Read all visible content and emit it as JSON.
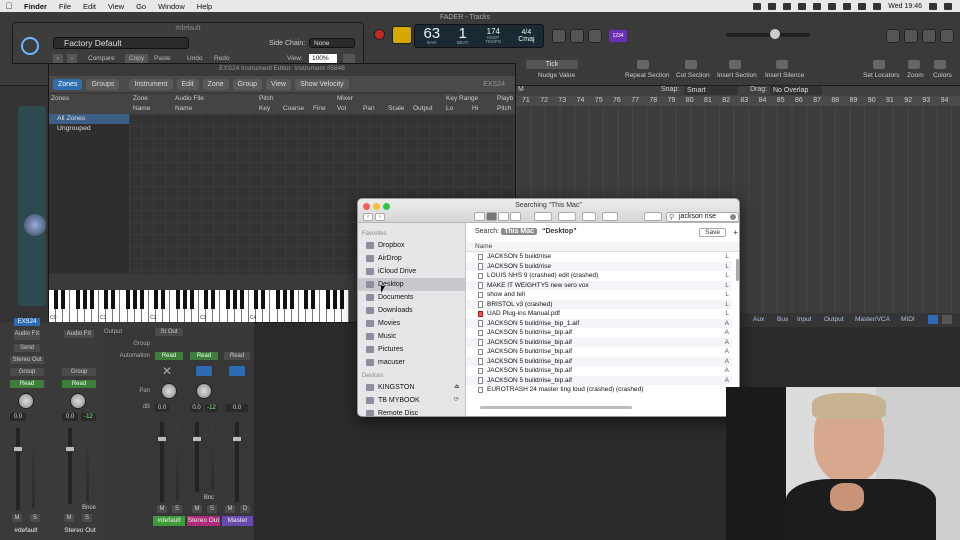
{
  "menubar": {
    "app": "Finder",
    "items": [
      "File",
      "Edit",
      "View",
      "Go",
      "Window",
      "Help"
    ],
    "clock": "Wed 19:46"
  },
  "logic": {
    "window_title": "FADER - Tracks",
    "lcd": {
      "bar": "63",
      "beat": "1",
      "bar_label": "BAR",
      "beat_label": "BEAT",
      "tempo": "174",
      "tempo_label": "TEMPO",
      "keep": "KEEP",
      "sig": "4/4",
      "key": "Cmaj"
    },
    "lcd_badge": "1234",
    "toolbar_labels": [
      "Repeat Section",
      "Cut Section",
      "Insert Section",
      "Insert Silence",
      "Set Locators",
      "Zoom",
      "Colors"
    ],
    "nudge": {
      "mode": "Tick",
      "label": "Nudge Value"
    },
    "snap": {
      "label": "Snap:",
      "value": "Smart"
    },
    "drag": {
      "label": "Drag:",
      "value": "No Overlap"
    },
    "marker_label": "M",
    "ruler": [
      "71",
      "72",
      "73",
      "74",
      "75",
      "76",
      "77",
      "78",
      "79",
      "80",
      "81",
      "82",
      "83",
      "84",
      "85",
      "86",
      "87",
      "88",
      "89",
      "90",
      "91",
      "92",
      "93",
      "94"
    ],
    "mixer_tabs": [
      "Aux",
      "Bus",
      "Input",
      "Output",
      "Master/VCA",
      "MIDI"
    ]
  },
  "plugin": {
    "title": "#default",
    "preset": "Factory Default",
    "sidechain_label": "Side Chain:",
    "sidechain_value": "None",
    "view_label": "View:",
    "view_value": "100%",
    "buttons": [
      "Compare",
      "Copy",
      "Paste",
      "Undo",
      "Redo"
    ]
  },
  "exs": {
    "title": "EXS24 Instrument Editor: Instrument #5846",
    "tabs": [
      "Zones",
      "Groups",
      "Instrument",
      "Edit",
      "Zone",
      "Group",
      "View",
      "Show Velocity"
    ],
    "badge": "EXS24",
    "col_groups": [
      "Zones",
      "Zone",
      "Audio File",
      "Pitch",
      "Mixer",
      "Key Range",
      "Playb"
    ],
    "cols": [
      "Name",
      "Name",
      "Key",
      "Coarse",
      "Fine",
      "Vol",
      "Pan",
      "Scale",
      "Output",
      "Lo",
      "Hi",
      "Pitch"
    ],
    "left_rows": [
      "All Zones",
      "Ungrouped"
    ],
    "keyboard_labels": [
      "C0",
      "C1",
      "C2",
      "C3",
      "C4"
    ]
  },
  "strips": {
    "inspector": {
      "eq": "EQ",
      "midi_fx": "MIDI FX",
      "inst": "EXS24",
      "audio_fx": "Audio FX",
      "send": "Send",
      "stereo_out": "Stereo Out",
      "group": "Group",
      "read": "Read",
      "vol": "0.0",
      "bounce": "Bnce"
    },
    "row_labels": [
      "Output",
      "Group",
      "Automation",
      "Pan",
      "dB"
    ],
    "channels": [
      {
        "name": "#default",
        "out": "St Out",
        "read": "Read",
        "db": "0.0",
        "color": "#3f9a3a"
      },
      {
        "name": "Stereo Out",
        "read": "Read",
        "db": "0.0",
        "db2": "-12",
        "color": "#b02a7a",
        "bounce": "Bnc"
      },
      {
        "name": "Master",
        "read": "Read",
        "db": "0.0",
        "color": "#6a4ab0"
      }
    ],
    "left_channel_names": [
      "#default",
      "Stereo Out"
    ],
    "left_db": [
      "0.0",
      "-12"
    ],
    "ms": [
      "M",
      "S",
      "M",
      "S",
      "M",
      "S",
      "M",
      "S",
      "M",
      "D"
    ]
  },
  "finder": {
    "title": "Searching “This Mac”",
    "search_value": "jackson rise",
    "search_label": "Search:",
    "scope_on": "This Mac",
    "scope_off": "“Desktop”",
    "save_label": "Save",
    "col_name": "Name",
    "favorites_header": "Favorites",
    "favorites": [
      "Dropbox",
      "AirDrop",
      "iCloud Drive",
      "Desktop",
      "Documents",
      "Downloads",
      "Movies",
      "Music",
      "Pictures",
      "macuser"
    ],
    "devices_header": "Devices",
    "devices": [
      "KINGSTON",
      "TB MYBOOK",
      "Remote Disc"
    ],
    "files": [
      {
        "name": "JACKSON 5 build/rise",
        "kind": "L"
      },
      {
        "name": "JACKSON 5 build/rise",
        "kind": "L"
      },
      {
        "name": "LOUIS NHS 9 (crashed)  edit (crashed)",
        "kind": "L"
      },
      {
        "name": "MAKE IT WEIGHTY5 new sero vox",
        "kind": "L"
      },
      {
        "name": "show and tell",
        "kind": "L"
      },
      {
        "name": "BRISTOL v3 (crashed)",
        "kind": "L"
      },
      {
        "name": "UAD Plug-ins Manual.pdf",
        "kind": "L",
        "pdf": true
      },
      {
        "name": "JACKSON 5 build/rise_bip_1.aif",
        "kind": "A"
      },
      {
        "name": "JACKSON 5 build/rise_bip.aif",
        "kind": "A"
      },
      {
        "name": "JACKSON 5 build/rise_bip.aif",
        "kind": "A"
      },
      {
        "name": "JACKSON 5 build/rise_bip.aif",
        "kind": "A"
      },
      {
        "name": "JACKSON 5 build/rise_bip.aif",
        "kind": "A"
      },
      {
        "name": "JACKSON 5 build/rise_bip.aif",
        "kind": "A"
      },
      {
        "name": "JACKSON 5 build/rise_bip.aif",
        "kind": "A"
      },
      {
        "name": "EUROTRASH 24 master ting loud (crashed) (crashed)",
        "kind": ""
      }
    ]
  }
}
